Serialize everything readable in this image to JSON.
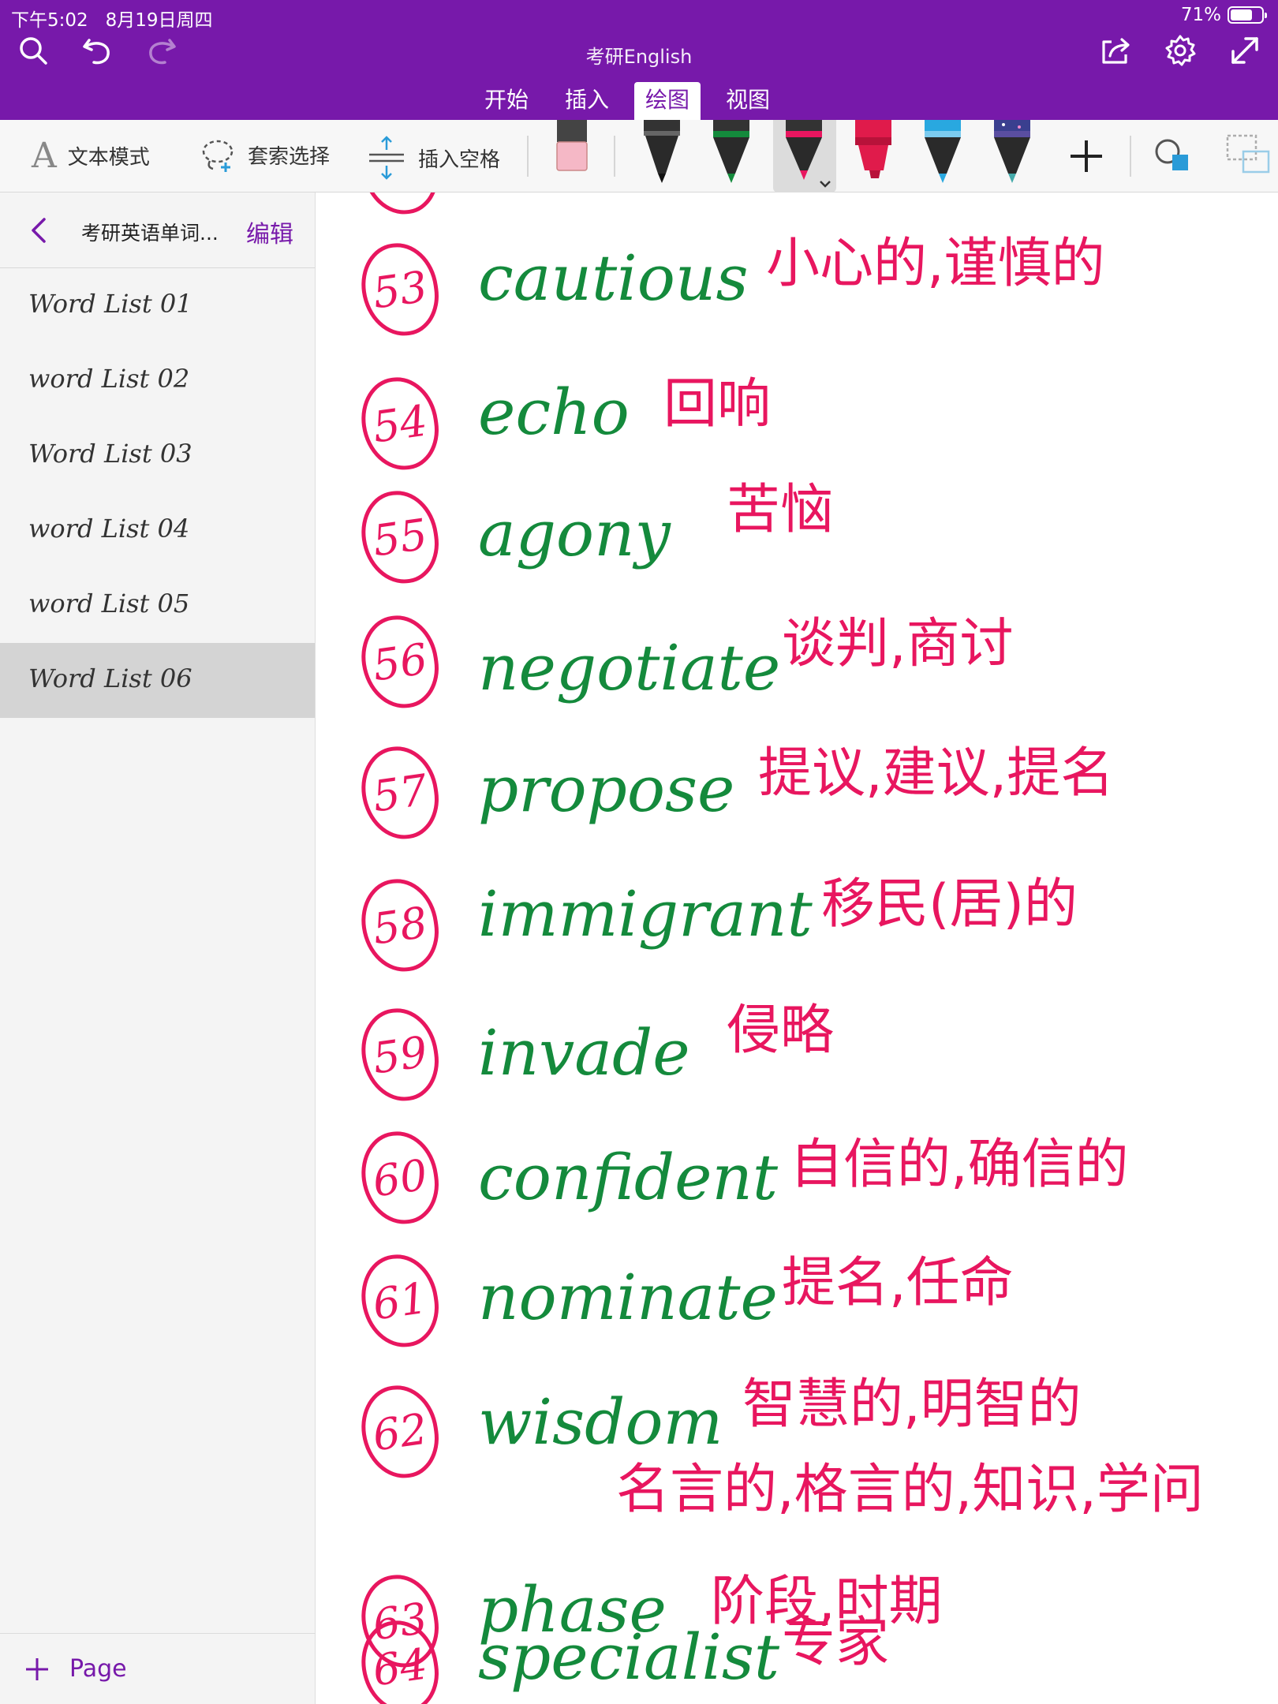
{
  "status": {
    "time": "下午5:02",
    "date": "8月19日周四",
    "battery_percent": 71,
    "battery_label": "71%"
  },
  "header": {
    "doc_title": "考研English",
    "tabs": [
      {
        "label": "开始",
        "active": false
      },
      {
        "label": "插入",
        "active": false
      },
      {
        "label": "绘图",
        "active": true
      },
      {
        "label": "视图",
        "active": false
      }
    ],
    "icons": [
      "search-icon",
      "undo-icon",
      "redo-icon",
      "share-icon",
      "settings-icon",
      "expand-icon"
    ]
  },
  "ribbon": {
    "text_mode": "文本模式",
    "lasso_select": "套索选择",
    "insert_space": "插入空格",
    "pens": [
      {
        "name": "eraser",
        "color": "#f5b8c6"
      },
      {
        "name": "black-pen",
        "color": "#222222"
      },
      {
        "name": "green-pen",
        "color": "#148a3c"
      },
      {
        "name": "pink-pen",
        "color": "#e8165f",
        "selected": true
      },
      {
        "name": "red-highlighter",
        "color": "#e01b4b"
      },
      {
        "name": "blue-pen",
        "color": "#29a8e0"
      },
      {
        "name": "galaxy-pen",
        "color": "#5a4ea0"
      }
    ],
    "colors": {
      "accent": "#7719aa",
      "ink_green": "#148a3c",
      "ink_pink": "#e8165f"
    }
  },
  "sidebar": {
    "section_title": "考研英语单词...",
    "edit_label": "编辑",
    "pages": [
      {
        "label": "Word List 01",
        "selected": false
      },
      {
        "label": "word List 02",
        "selected": false
      },
      {
        "label": "Word List 03",
        "selected": false
      },
      {
        "label": "word List 04",
        "selected": false
      },
      {
        "label": "word List 05",
        "selected": false
      },
      {
        "label": "Word List 06",
        "selected": true
      }
    ],
    "add_page_label": "Page"
  },
  "notes": [
    {
      "num": "53",
      "word": "cautious",
      "def": "小心的,谨慎的"
    },
    {
      "num": "54",
      "word": "echo",
      "def": "回响"
    },
    {
      "num": "55",
      "word": "agony",
      "def": "苦恼"
    },
    {
      "num": "56",
      "word": "negotiate",
      "def": "谈判,商讨"
    },
    {
      "num": "57",
      "word": "propose",
      "def": "提议,建议,提名"
    },
    {
      "num": "58",
      "word": "immigrant",
      "def": "移民(居)的"
    },
    {
      "num": "59",
      "word": "invade",
      "def": "侵略"
    },
    {
      "num": "60",
      "word": "confident",
      "def": "自信的,确信的"
    },
    {
      "num": "61",
      "word": "nominate",
      "def": "提名,任命"
    },
    {
      "num": "62",
      "word": "wisdom",
      "def": "智慧的,明智的",
      "def2": "名言的,格言的,知识,学问"
    },
    {
      "num": "63",
      "word": "phase",
      "def": "阶段,时期"
    },
    {
      "num": "64",
      "word": "specialist",
      "def": "专家"
    }
  ]
}
